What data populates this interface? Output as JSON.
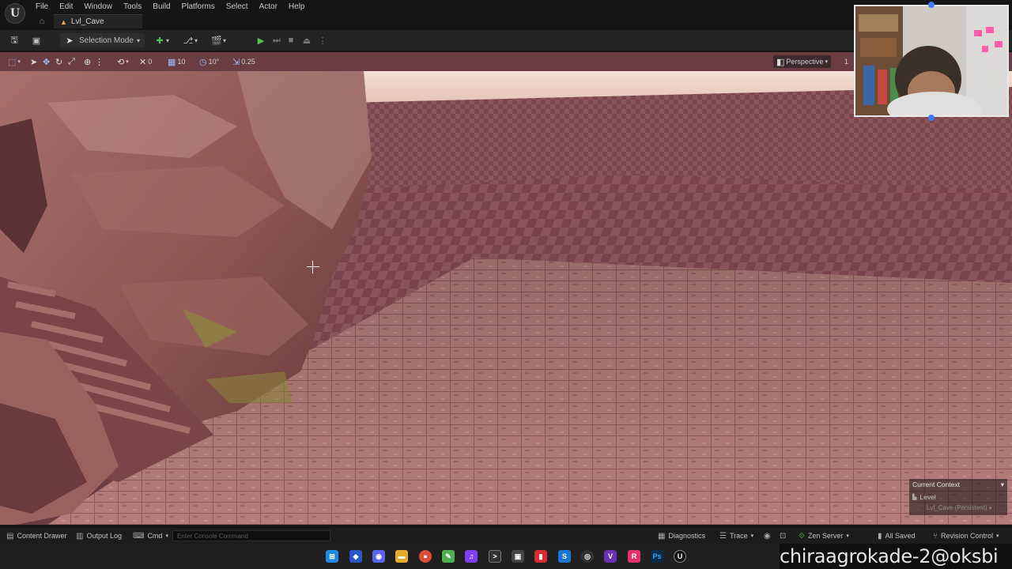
{
  "menu": {
    "items": [
      "File",
      "Edit",
      "Window",
      "Tools",
      "Build",
      "Platforms",
      "Select",
      "Actor",
      "Help"
    ]
  },
  "level_tab": {
    "label": "Lvl_Cave"
  },
  "toolbar": {
    "selection_mode_label": "Selection Mode",
    "play_color": "#4fc24f"
  },
  "viewport_toolbar": {
    "translate_snap": "10",
    "rotate_snap": "10°",
    "scale_snap": "0.25",
    "camera_speed_prefix": "0",
    "view_mode": "Perspective",
    "camera_speed": "1"
  },
  "context": {
    "title": "Current Context",
    "level_label": "Level",
    "persistent_label": "Lvl_Cave (Persistent)"
  },
  "statusbar": {
    "content_drawer": "Content Drawer",
    "output_log": "Output Log",
    "cmd": "Cmd",
    "console_placeholder": "Enter Console Command",
    "diagnostics": "Diagnostics",
    "trace": "Trace",
    "zen_server": "Zen Server",
    "all_saved": "All Saved",
    "revision_control": "Revision Control"
  },
  "taskbar": {
    "icons": [
      "windows-start",
      "copilot",
      "discord",
      "file-explorer",
      "chrome",
      "notepad",
      "headset",
      "terminal",
      "red-app",
      "blue-app",
      "github",
      "visual-studio",
      "jetbrains",
      "photoshop",
      "unreal-engine"
    ]
  },
  "watermark": {
    "text": "chiraagrokade-2@oksbi"
  }
}
